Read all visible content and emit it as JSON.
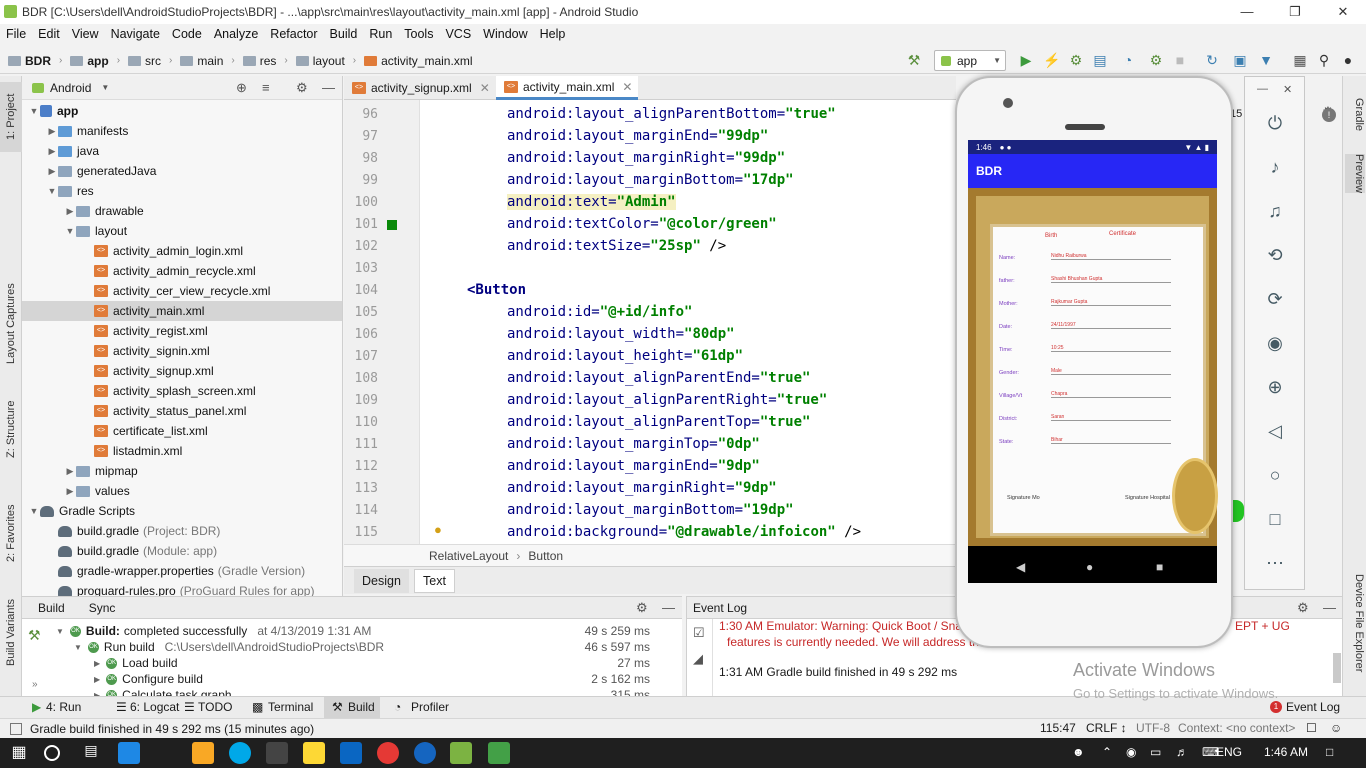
{
  "window": {
    "title": "BDR [C:\\Users\\dell\\AndroidStudioProjects\\BDR] - ...\\app\\src\\main\\res\\layout\\activity_main.xml [app] - Android Studio"
  },
  "menu": [
    "File",
    "Edit",
    "View",
    "Navigate",
    "Code",
    "Analyze",
    "Refactor",
    "Build",
    "Run",
    "Tools",
    "VCS",
    "Window",
    "Help"
  ],
  "breadcrumb": [
    "BDR",
    "app",
    "src",
    "main",
    "res",
    "layout",
    "activity_main.xml"
  ],
  "run_config": "app",
  "left_tabs": [
    "1: Project",
    "Layout Captures",
    "Z: Structure",
    "2: Favorites",
    "Build Variants"
  ],
  "right_tabs": [
    "Gradle",
    "Preview",
    "Device File Explorer"
  ],
  "project": {
    "view_mode": "Android",
    "tree": [
      {
        "label": "app",
        "depth": 0,
        "icon": "app",
        "bold": true,
        "arrow": "down"
      },
      {
        "label": "manifests",
        "depth": 1,
        "icon": "folder-blue",
        "arrow": "right"
      },
      {
        "label": "java",
        "depth": 1,
        "icon": "folder-blue",
        "arrow": "right"
      },
      {
        "label": "generatedJava",
        "depth": 1,
        "icon": "folder",
        "arrow": "right"
      },
      {
        "label": "res",
        "depth": 1,
        "icon": "folder",
        "arrow": "down"
      },
      {
        "label": "drawable",
        "depth": 2,
        "icon": "folder",
        "arrow": "right"
      },
      {
        "label": "layout",
        "depth": 2,
        "icon": "folder",
        "arrow": "down"
      },
      {
        "label": "activity_admin_login.xml",
        "depth": 3,
        "icon": "xml"
      },
      {
        "label": "activity_admin_recycle.xml",
        "depth": 3,
        "icon": "xml"
      },
      {
        "label": "activity_cer_view_recycle.xml",
        "depth": 3,
        "icon": "xml"
      },
      {
        "label": "activity_main.xml",
        "depth": 3,
        "icon": "xml",
        "selected": true
      },
      {
        "label": "activity_regist.xml",
        "depth": 3,
        "icon": "xml"
      },
      {
        "label": "activity_signin.xml",
        "depth": 3,
        "icon": "xml"
      },
      {
        "label": "activity_signup.xml",
        "depth": 3,
        "icon": "xml"
      },
      {
        "label": "activity_splash_screen.xml",
        "depth": 3,
        "icon": "xml"
      },
      {
        "label": "activity_status_panel.xml",
        "depth": 3,
        "icon": "xml"
      },
      {
        "label": "certificate_list.xml",
        "depth": 3,
        "icon": "xml"
      },
      {
        "label": "listadmin.xml",
        "depth": 3,
        "icon": "xml"
      },
      {
        "label": "mipmap",
        "depth": 2,
        "icon": "folder",
        "arrow": "right"
      },
      {
        "label": "values",
        "depth": 2,
        "icon": "folder",
        "arrow": "right"
      },
      {
        "label": "Gradle Scripts",
        "depth": 0,
        "icon": "gradle",
        "arrow": "down"
      },
      {
        "label": "build.gradle",
        "depth": 1,
        "icon": "gradle",
        "note": "(Project: BDR)"
      },
      {
        "label": "build.gradle",
        "depth": 1,
        "icon": "gradle",
        "note": "(Module: app)"
      },
      {
        "label": "gradle-wrapper.properties",
        "depth": 1,
        "icon": "gradle",
        "note": "(Gradle Version)"
      },
      {
        "label": "proguard-rules.pro",
        "depth": 1,
        "icon": "gradle",
        "note": "(ProGuard Rules for app)"
      }
    ]
  },
  "editor": {
    "tabs": [
      {
        "label": "activity_signup.xml",
        "active": false
      },
      {
        "label": "activity_main.xml",
        "active": true
      }
    ],
    "lines": [
      {
        "n": "96",
        "attr": "android:layout_alignParentBottom=",
        "val": "\"true\""
      },
      {
        "n": "97",
        "attr": "android:layout_marginEnd=",
        "val": "\"99dp\""
      },
      {
        "n": "98",
        "attr": "android:layout_marginRight=",
        "val": "\"99dp\""
      },
      {
        "n": "99",
        "attr": "android:layout_marginBottom=",
        "val": "\"17dp\""
      },
      {
        "n": "100",
        "attr": "android:text=",
        "val": "\"Admin\"",
        "hl": true
      },
      {
        "n": "101",
        "attr": "android:textColor=",
        "val": "\"@color/green\""
      },
      {
        "n": "102",
        "attr": "android:textSize=",
        "val": "\"25sp\"",
        "tail": " />"
      },
      {
        "n": "103",
        "attr": "",
        "val": ""
      },
      {
        "n": "104",
        "tag": "<Button"
      },
      {
        "n": "105",
        "attr": "android:id=",
        "val": "\"@+id/info\""
      },
      {
        "n": "106",
        "attr": "android:layout_width=",
        "val": "\"80dp\""
      },
      {
        "n": "107",
        "attr": "android:layout_height=",
        "val": "\"61dp\""
      },
      {
        "n": "108",
        "attr": "android:layout_alignParentEnd=",
        "val": "\"true\""
      },
      {
        "n": "109",
        "attr": "android:layout_alignParentRight=",
        "val": "\"true\""
      },
      {
        "n": "110",
        "attr": "android:layout_alignParentTop=",
        "val": "\"true\""
      },
      {
        "n": "111",
        "attr": "android:layout_marginTop=",
        "val": "\"0dp\""
      },
      {
        "n": "112",
        "attr": "android:layout_marginEnd=",
        "val": "\"9dp\""
      },
      {
        "n": "113",
        "attr": "android:layout_marginRight=",
        "val": "\"9dp\""
      },
      {
        "n": "114",
        "attr": "android:layout_marginBottom=",
        "val": "\"19dp\""
      },
      {
        "n": "115",
        "attr": "android:background=",
        "val": "\"@drawable/infoicon\"",
        "tail": " />"
      }
    ],
    "breadcrumb": [
      "RelativeLayout",
      "Button"
    ],
    "mode_tabs": [
      "Design",
      "Text"
    ]
  },
  "build": {
    "tabs": [
      "Build",
      "Sync"
    ],
    "rows": [
      {
        "label": "Build:",
        "rest": "completed successfully",
        "extra": "at 4/13/2019 1:31 AM",
        "time": "49 s 259 ms"
      },
      {
        "label": "Run build",
        "extra": "C:\\Users\\dell\\AndroidStudioProjects\\BDR",
        "time": "46 s 597 ms"
      },
      {
        "label": "Load build",
        "time": "27 ms"
      },
      {
        "label": "Configure build",
        "time": "2 s 162 ms"
      },
      {
        "label": "Calculate task graph",
        "time": "315 ms"
      }
    ]
  },
  "event_log": {
    "title": "Event Log",
    "lines": [
      "1:30 AM  Emulator: Warning: Quick Boot / Sna",
      "features is currently needed. We will address th",
      "1:31 AM  Gradle build finished in 49 s 292 ms"
    ],
    "trail1": "EPT + UG",
    "trail2": "15"
  },
  "tool_windows": [
    "4: Run",
    "6: Logcat",
    "TODO",
    "Terminal",
    "Build",
    "Profiler",
    "Event Log"
  ],
  "status": {
    "message": "Gradle build finished in 49 s 292 ms (15 minutes ago)",
    "position": "115:47",
    "crlf": "CRLF ↕",
    "encoding": "UTF-8",
    "context": "Context: <no context>"
  },
  "emulator": {
    "time": "1:46",
    "app_title": "BDR",
    "cert_fields": [
      "Name:",
      "father:",
      "Mother:",
      "Date:",
      "Time:",
      "Gender:",
      "Village/Vt",
      "District:",
      "State:"
    ],
    "cert_values": [
      "Nidhu Raiburwa",
      "Shashi Bhushan Gupta",
      "Rajkumar Gupta",
      "24/11/1997",
      "10:25",
      "Male",
      "Chapra",
      "Saran",
      "Bihar"
    ],
    "cert_heading": [
      "Birth",
      "Certificate"
    ],
    "sig_left": "Signature Mo",
    "sig_right": "Signature Hospital"
  },
  "watermark": {
    "line1": "Activate Windows",
    "line2": "Go to Settings to activate Windows."
  },
  "taskbar": {
    "lang": "ENG",
    "time": "1:46 AM"
  },
  "colors": {
    "accent": "#4a88c7",
    "code_attr": "#000080",
    "code_value": "#008000",
    "app_bar": "#2727f5"
  }
}
